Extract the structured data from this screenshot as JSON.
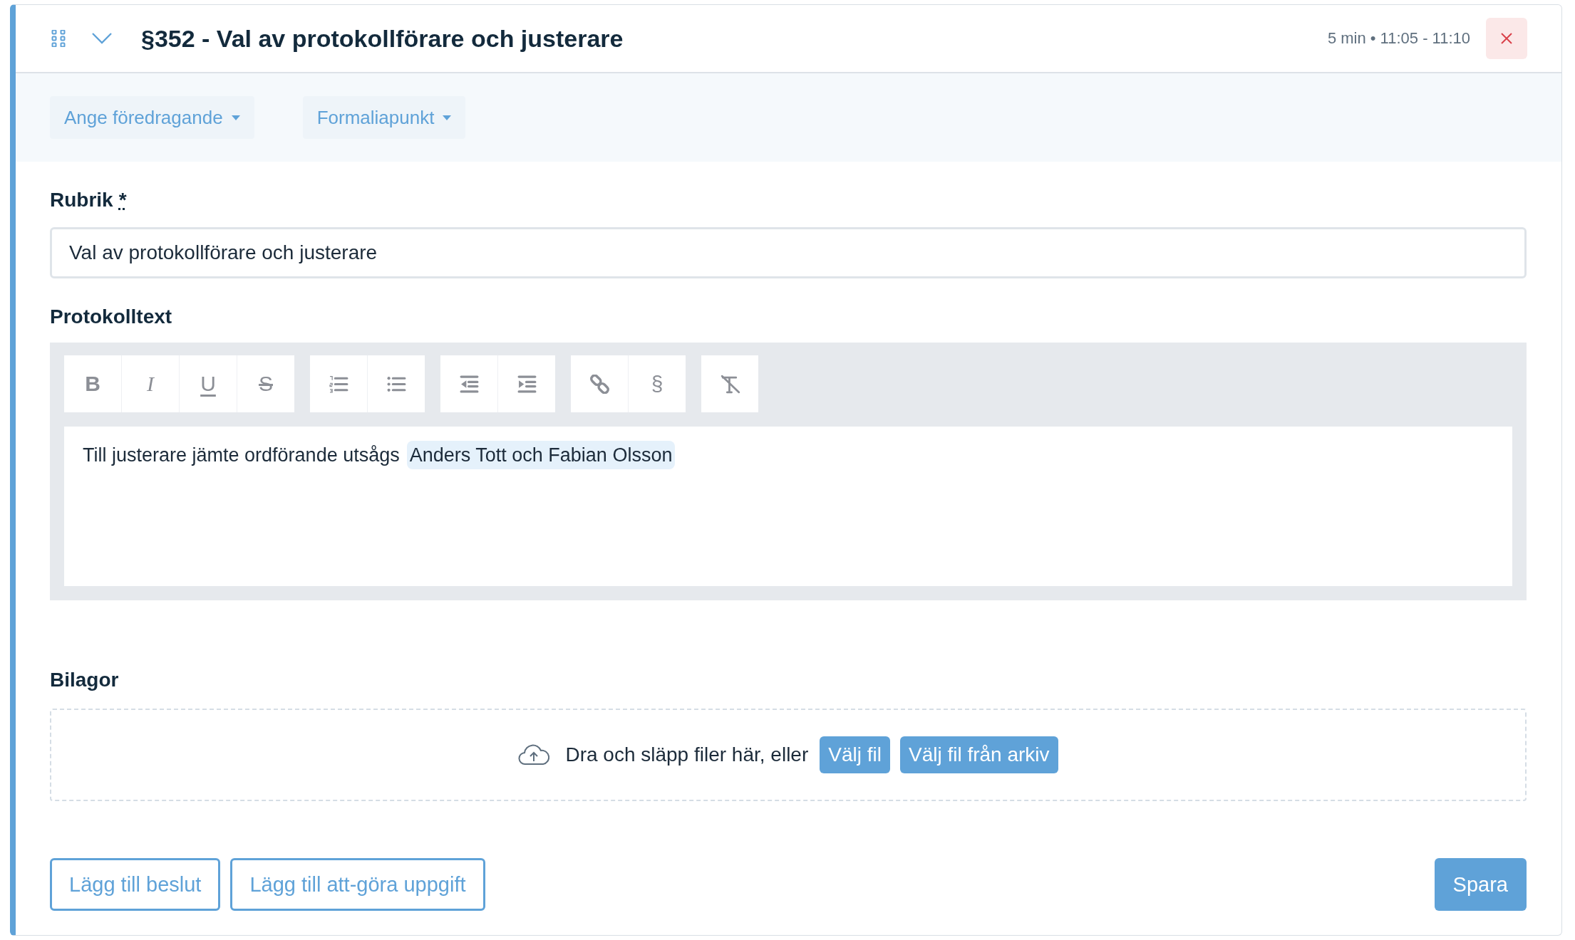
{
  "header": {
    "title": "§352 - Val av protokollförare och justerare",
    "time": "5 min • 11:05 - 11:10"
  },
  "dropdowns": [
    "Ange föredragande",
    "Formaliapunkt"
  ],
  "rubrik": {
    "label": "Rubrik",
    "required_mark": "*",
    "value": "Val av protokollförare och justerare"
  },
  "protokolltext": {
    "label": "Protokolltext",
    "toolbar": [
      [
        {
          "kind": "bold",
          "label": "B"
        },
        {
          "kind": "italic",
          "label": "I"
        },
        {
          "kind": "underline",
          "label": "U"
        },
        {
          "kind": "strike",
          "label": "S"
        }
      ],
      [
        {
          "kind": "ordered-list"
        },
        {
          "kind": "bullet-list"
        }
      ],
      [
        {
          "kind": "outdent"
        },
        {
          "kind": "indent"
        }
      ],
      [
        {
          "kind": "link"
        },
        {
          "kind": "section",
          "label": "§"
        }
      ],
      [
        {
          "kind": "clear-format"
        }
      ]
    ],
    "content": [
      {
        "text": "Till justerare jämte ordförande utsågs",
        "highlighted": false
      },
      {
        "text": "Anders Tott och Fabian Olsson",
        "highlighted": true
      }
    ]
  },
  "bilagor": {
    "label": "Bilagor",
    "drop_text": "Dra och släpp filer här, eller",
    "buttons": [
      "Välj fil",
      "Välj fil från arkiv"
    ]
  },
  "footer": {
    "buttons": [
      "Lägg till beslut",
      "Lägg till att-göra uppgift"
    ],
    "save": "Spara"
  }
}
